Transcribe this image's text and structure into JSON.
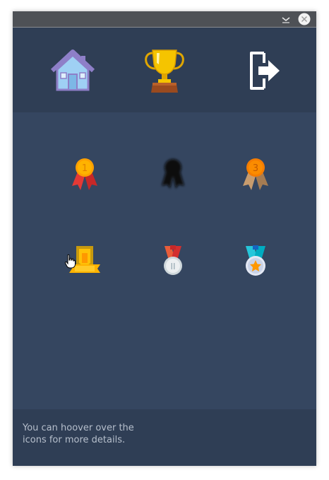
{
  "window": {
    "titlebar_buttons": {
      "minimize": "chevron-down-icon",
      "close": "close-icon"
    }
  },
  "nav": {
    "items": [
      {
        "id": "home",
        "icon": "home-icon"
      },
      {
        "id": "trophy",
        "icon": "trophy-icon"
      },
      {
        "id": "exit",
        "icon": "exit-icon"
      }
    ]
  },
  "achievements": [
    {
      "icon": "medal-gold-1-icon",
      "state": "unlocked"
    },
    {
      "icon": "medal-locked-icon",
      "state": "locked"
    },
    {
      "icon": "medal-bronze-3-icon",
      "state": "unlocked"
    },
    {
      "icon": "badge-ribbon-icon",
      "state": "unlocked"
    },
    {
      "icon": "medal-silver-2-icon",
      "state": "unlocked"
    },
    {
      "icon": "medal-star-icon",
      "state": "unlocked"
    }
  ],
  "footer": {
    "hint_line1": "You can hoover over the",
    "hint_line2": "icons for more details."
  },
  "colors": {
    "panel": "#354660",
    "header": "#2f3e55",
    "footer": "#2f3e55",
    "hint_text": "#b6bfcc"
  }
}
